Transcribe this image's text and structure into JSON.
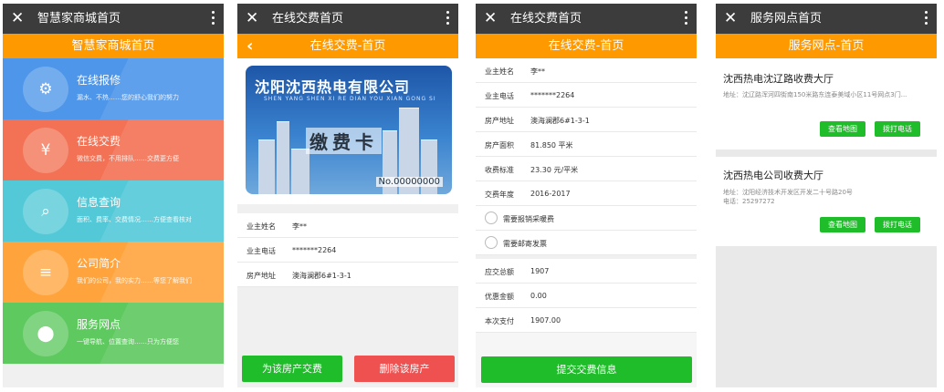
{
  "screens": {
    "mall": {
      "topbar_title": "智慧家商城首页",
      "header": "智慧家商城首页",
      "menu": [
        {
          "title": "在线报修",
          "sub": "漏水、不热……您的舒心我们的努力",
          "color": "#4d96ea",
          "icon": "⚙"
        },
        {
          "title": "在线交费",
          "sub": "微信交费，不用排队……交费更方便",
          "color": "#f37154",
          "icon": "¥"
        },
        {
          "title": "信息查询",
          "sub": "面积、费率、交费情况……方便查看核对",
          "color": "#53c9d8",
          "icon": "⌕"
        },
        {
          "title": "公司简介",
          "sub": "我们的公司，我的实力……等您了解我们",
          "color": "#ffa43d",
          "icon": "≡"
        },
        {
          "title": "服务网点",
          "sub": "一键导航、位置查询……只为方便您",
          "color": "#5ec95f",
          "icon": "⬤"
        }
      ]
    },
    "payment": {
      "topbar_title": "在线交费首页",
      "header": "在线交费-首页",
      "card": {
        "company": "沈阳沈西热电有限公司",
        "english": "SHEN YANG SHEN XI RE DIAN YOU XIAN GONG SI",
        "title": "缴费卡",
        "number": "No.00000000"
      },
      "fields": [
        {
          "label": "业主姓名",
          "value": "李**"
        },
        {
          "label": "业主电话",
          "value": "*******2264"
        },
        {
          "label": "房产地址",
          "value": "澳海澜郡6#1-3-1"
        }
      ],
      "pay_button": "为该房产交费",
      "delete_button": "删除该房产"
    },
    "payment_detail": {
      "topbar_title": "在线交费首页",
      "header": "在线交费-首页",
      "fields": [
        {
          "label": "业主姓名",
          "value": "李**"
        },
        {
          "label": "业主电话",
          "value": "*******2264"
        },
        {
          "label": "房产地址",
          "value": "澳海澜郡6#1-3-1"
        },
        {
          "label": "房产面积",
          "value": "81.850  平米"
        },
        {
          "label": "收费标准",
          "value": "23.30  元/平米"
        },
        {
          "label": "交费年度",
          "value": "2016-2017"
        }
      ],
      "options": [
        "需要报销采暖费",
        "需要邮寄发票"
      ],
      "amounts": [
        {
          "label": "应交总额",
          "value": "1907"
        },
        {
          "label": "优惠金额",
          "value": "0.00"
        },
        {
          "label": "本次支付",
          "value": "1907.00"
        }
      ],
      "submit_button": "提交交费信息"
    },
    "service": {
      "topbar_title": "服务网点首页",
      "header": "服务网点-首页",
      "sites": [
        {
          "name": "沈西热电沈辽路收费大厅",
          "address": "地址：沈辽路浑河四街南150米路东连泰美域小区11号网点3门...",
          "phone": ""
        },
        {
          "name": "沈西热电公司收费大厅",
          "address": "地址：沈阳经济技术开发区开发二十号路20号",
          "phone": "电话：25297272"
        }
      ],
      "map_button": "查看地图",
      "call_button": "拨打电话"
    }
  }
}
